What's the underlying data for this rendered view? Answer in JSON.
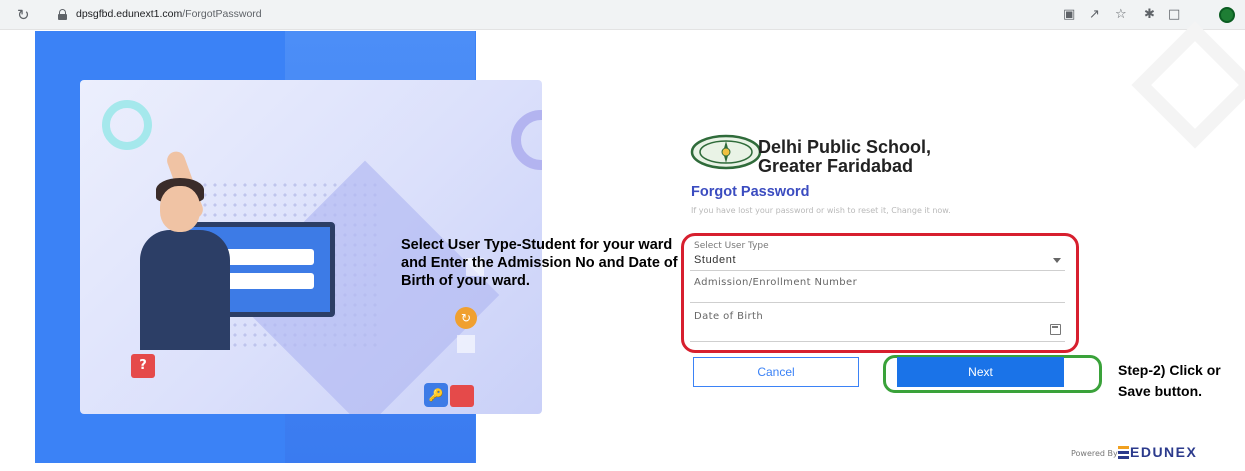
{
  "browser": {
    "url_domain": "dpsgfbd.edunext1.com",
    "url_path": "/ForgotPassword"
  },
  "illustration": {
    "question_mark": "?"
  },
  "annotation_left": "Select User Type-Student for your ward and Enter the Admission No and Date of Birth of your ward.",
  "school": {
    "name_line1": "Delhi Public School,",
    "name_line2": "Greater Faridabad"
  },
  "form": {
    "title": "Forgot Password",
    "subtitle": "If you have lost your password or wish to reset it, Change it now.",
    "user_type_label": "Select User Type",
    "user_type_value": "Student",
    "admission_label": "Admission/Enrollment Number",
    "dob_label": "Date of Birth",
    "cancel_label": "Cancel",
    "next_label": "Next"
  },
  "annotation_right_line1": "Step-2) Click or",
  "annotation_right_line2": "Save button.",
  "footer": {
    "powered_by": "Powered By",
    "brand": "EDUNEX"
  },
  "colors": {
    "accent": "#3b82f6",
    "primary_button": "#1a73e8",
    "highlight_red": "#d71f2e",
    "highlight_green": "#3aa23a"
  }
}
